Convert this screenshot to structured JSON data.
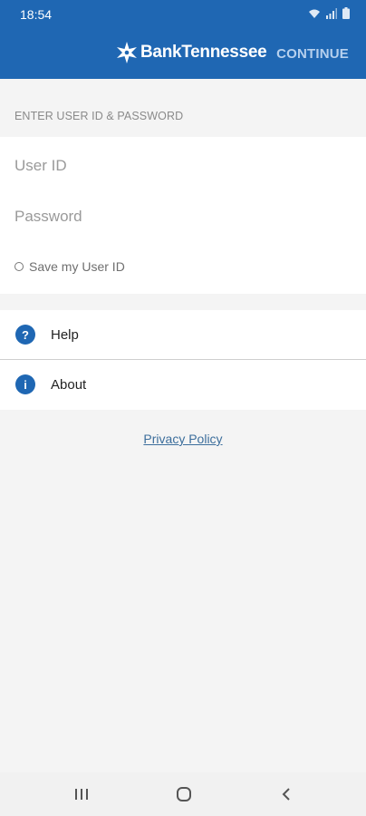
{
  "status_bar": {
    "time": "18:54",
    "icons": [
      "wifi-icon",
      "signal-icon",
      "battery-icon"
    ]
  },
  "header": {
    "brand": "BankTennessee",
    "continue_label": "CONTINUE"
  },
  "login": {
    "section_title": "ENTER USER ID & PASSWORD",
    "user_id_placeholder": "User ID",
    "user_id_value": "",
    "password_placeholder": "Password",
    "password_value": "",
    "save_user_id_label": "Save my User ID",
    "save_user_id_checked": false
  },
  "links": [
    {
      "label": "Help",
      "icon": "help-icon",
      "glyph": "?"
    },
    {
      "label": "About",
      "icon": "info-icon",
      "glyph": "i"
    }
  ],
  "privacy_policy_label": "Privacy Policy",
  "nav": {
    "buttons": [
      "recent-apps-icon",
      "home-icon",
      "back-icon"
    ]
  },
  "colors": {
    "primary": "#1f67b3",
    "continue_text": "#b6d0ee",
    "background": "#f4f4f4",
    "link": "#3c6e9c"
  }
}
